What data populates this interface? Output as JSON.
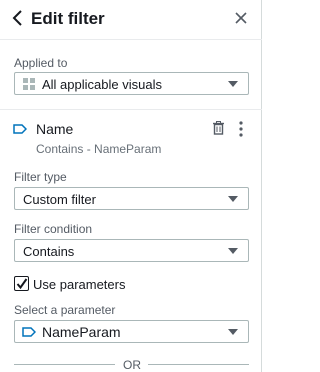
{
  "header": {
    "title": "Edit filter",
    "back_icon": "chevron-left-icon",
    "close_icon": "close-icon"
  },
  "applied_to": {
    "label": "Applied to",
    "value": "All applicable visuals",
    "icon": "grid-icon"
  },
  "filter": {
    "name": "Name",
    "subtitle": "Contains - NameParam",
    "field_icon": "dimension-tag-icon",
    "delete_icon": "trash-icon",
    "more_icon": "kebab-menu-icon"
  },
  "filter_type": {
    "label": "Filter type",
    "value": "Custom filter"
  },
  "filter_condition": {
    "label": "Filter condition",
    "value": "Contains"
  },
  "use_parameters": {
    "label": "Use parameters",
    "checked": true
  },
  "parameter": {
    "label": "Select a parameter",
    "value": "NameParam",
    "icon": "parameter-tag-icon"
  },
  "divider": {
    "text": "OR"
  },
  "colors": {
    "accent": "#0073bb",
    "text": "#16191f",
    "muted": "#545b64",
    "border": "#aab7b8"
  }
}
